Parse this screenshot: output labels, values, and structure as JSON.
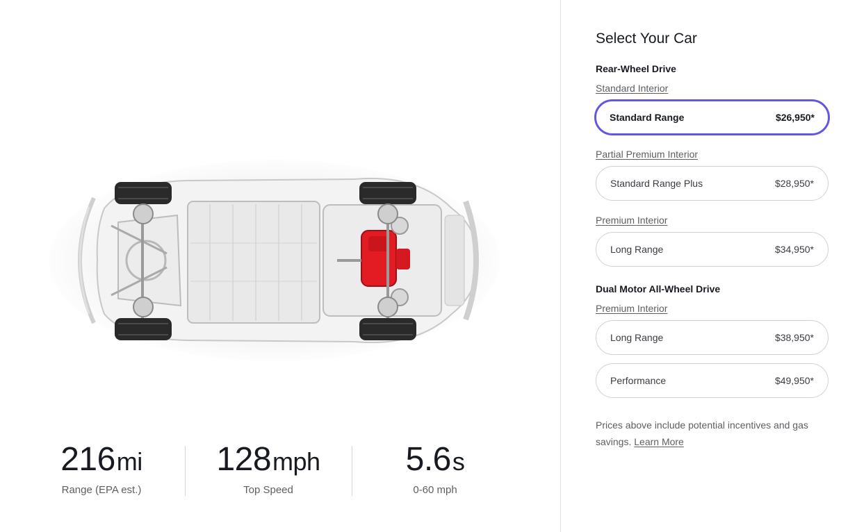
{
  "stats": [
    {
      "value": "216",
      "unit": "mi",
      "label": "Range (EPA est.)"
    },
    {
      "value": "128",
      "unit": "mph",
      "label": "Top Speed"
    },
    {
      "value": "5.6",
      "unit": "s",
      "label": "0-60 mph"
    }
  ],
  "panel": {
    "title": "Select Your Car",
    "groups": [
      {
        "title": "Rear-Wheel Drive",
        "sections": [
          {
            "interior": "Standard Interior",
            "options": [
              {
                "name": "Standard Range",
                "price": "$26,950*",
                "selected": true
              }
            ]
          },
          {
            "interior": "Partial Premium Interior",
            "options": [
              {
                "name": "Standard Range Plus",
                "price": "$28,950*"
              }
            ]
          },
          {
            "interior": "Premium Interior",
            "options": [
              {
                "name": "Long Range",
                "price": "$34,950*"
              }
            ]
          }
        ]
      },
      {
        "title": "Dual Motor All-Wheel Drive",
        "sections": [
          {
            "interior": "Premium Interior",
            "options": [
              {
                "name": "Long Range",
                "price": "$38,950*"
              },
              {
                "name": "Performance",
                "price": "$49,950*"
              }
            ]
          }
        ]
      }
    ],
    "note_text": "Prices above include potential incentives and gas savings.",
    "note_link": "Learn More"
  },
  "colors": {
    "accent": "#6356e0",
    "motor": "#e31c24",
    "text": "#171a20",
    "muted": "#5c5e62"
  },
  "image": {
    "icon": "car-chassis-icon"
  }
}
